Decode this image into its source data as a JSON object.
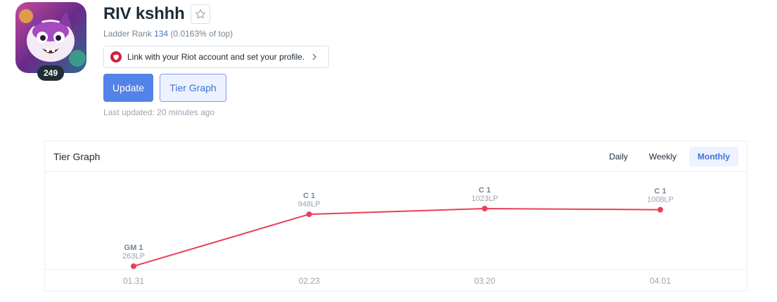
{
  "profile": {
    "name": "RIV kshhh",
    "level": "249",
    "ladder_label": "Ladder Rank",
    "ladder_rank": "134",
    "ladder_percent": "(0.0163% of top)",
    "riot_link_text": "Link with your Riot account and set your profile.",
    "update_label": "Update",
    "tier_graph_label": "Tier Graph",
    "last_updated": "Last updated: 20 minutes ago"
  },
  "graph": {
    "title": "Tier Graph",
    "tabs": [
      {
        "label": "Daily",
        "active": false
      },
      {
        "label": "Weekly",
        "active": false
      },
      {
        "label": "Monthly",
        "active": true
      }
    ]
  },
  "colors": {
    "accent": "#5383e8",
    "line": "#e84057",
    "riot": "#d0203c"
  },
  "chart_data": {
    "type": "line",
    "x": [
      "01.31",
      "02.23",
      "03.20",
      "04.01"
    ],
    "series": [
      {
        "values": [
          263,
          948,
          1023,
          1008
        ],
        "tiers": [
          "GM 1",
          "C 1",
          "C 1",
          "C 1"
        ],
        "labels": [
          "263LP",
          "948LP",
          "1023LP",
          "1008LP"
        ]
      }
    ],
    "title": "Tier Graph",
    "grid": false
  }
}
